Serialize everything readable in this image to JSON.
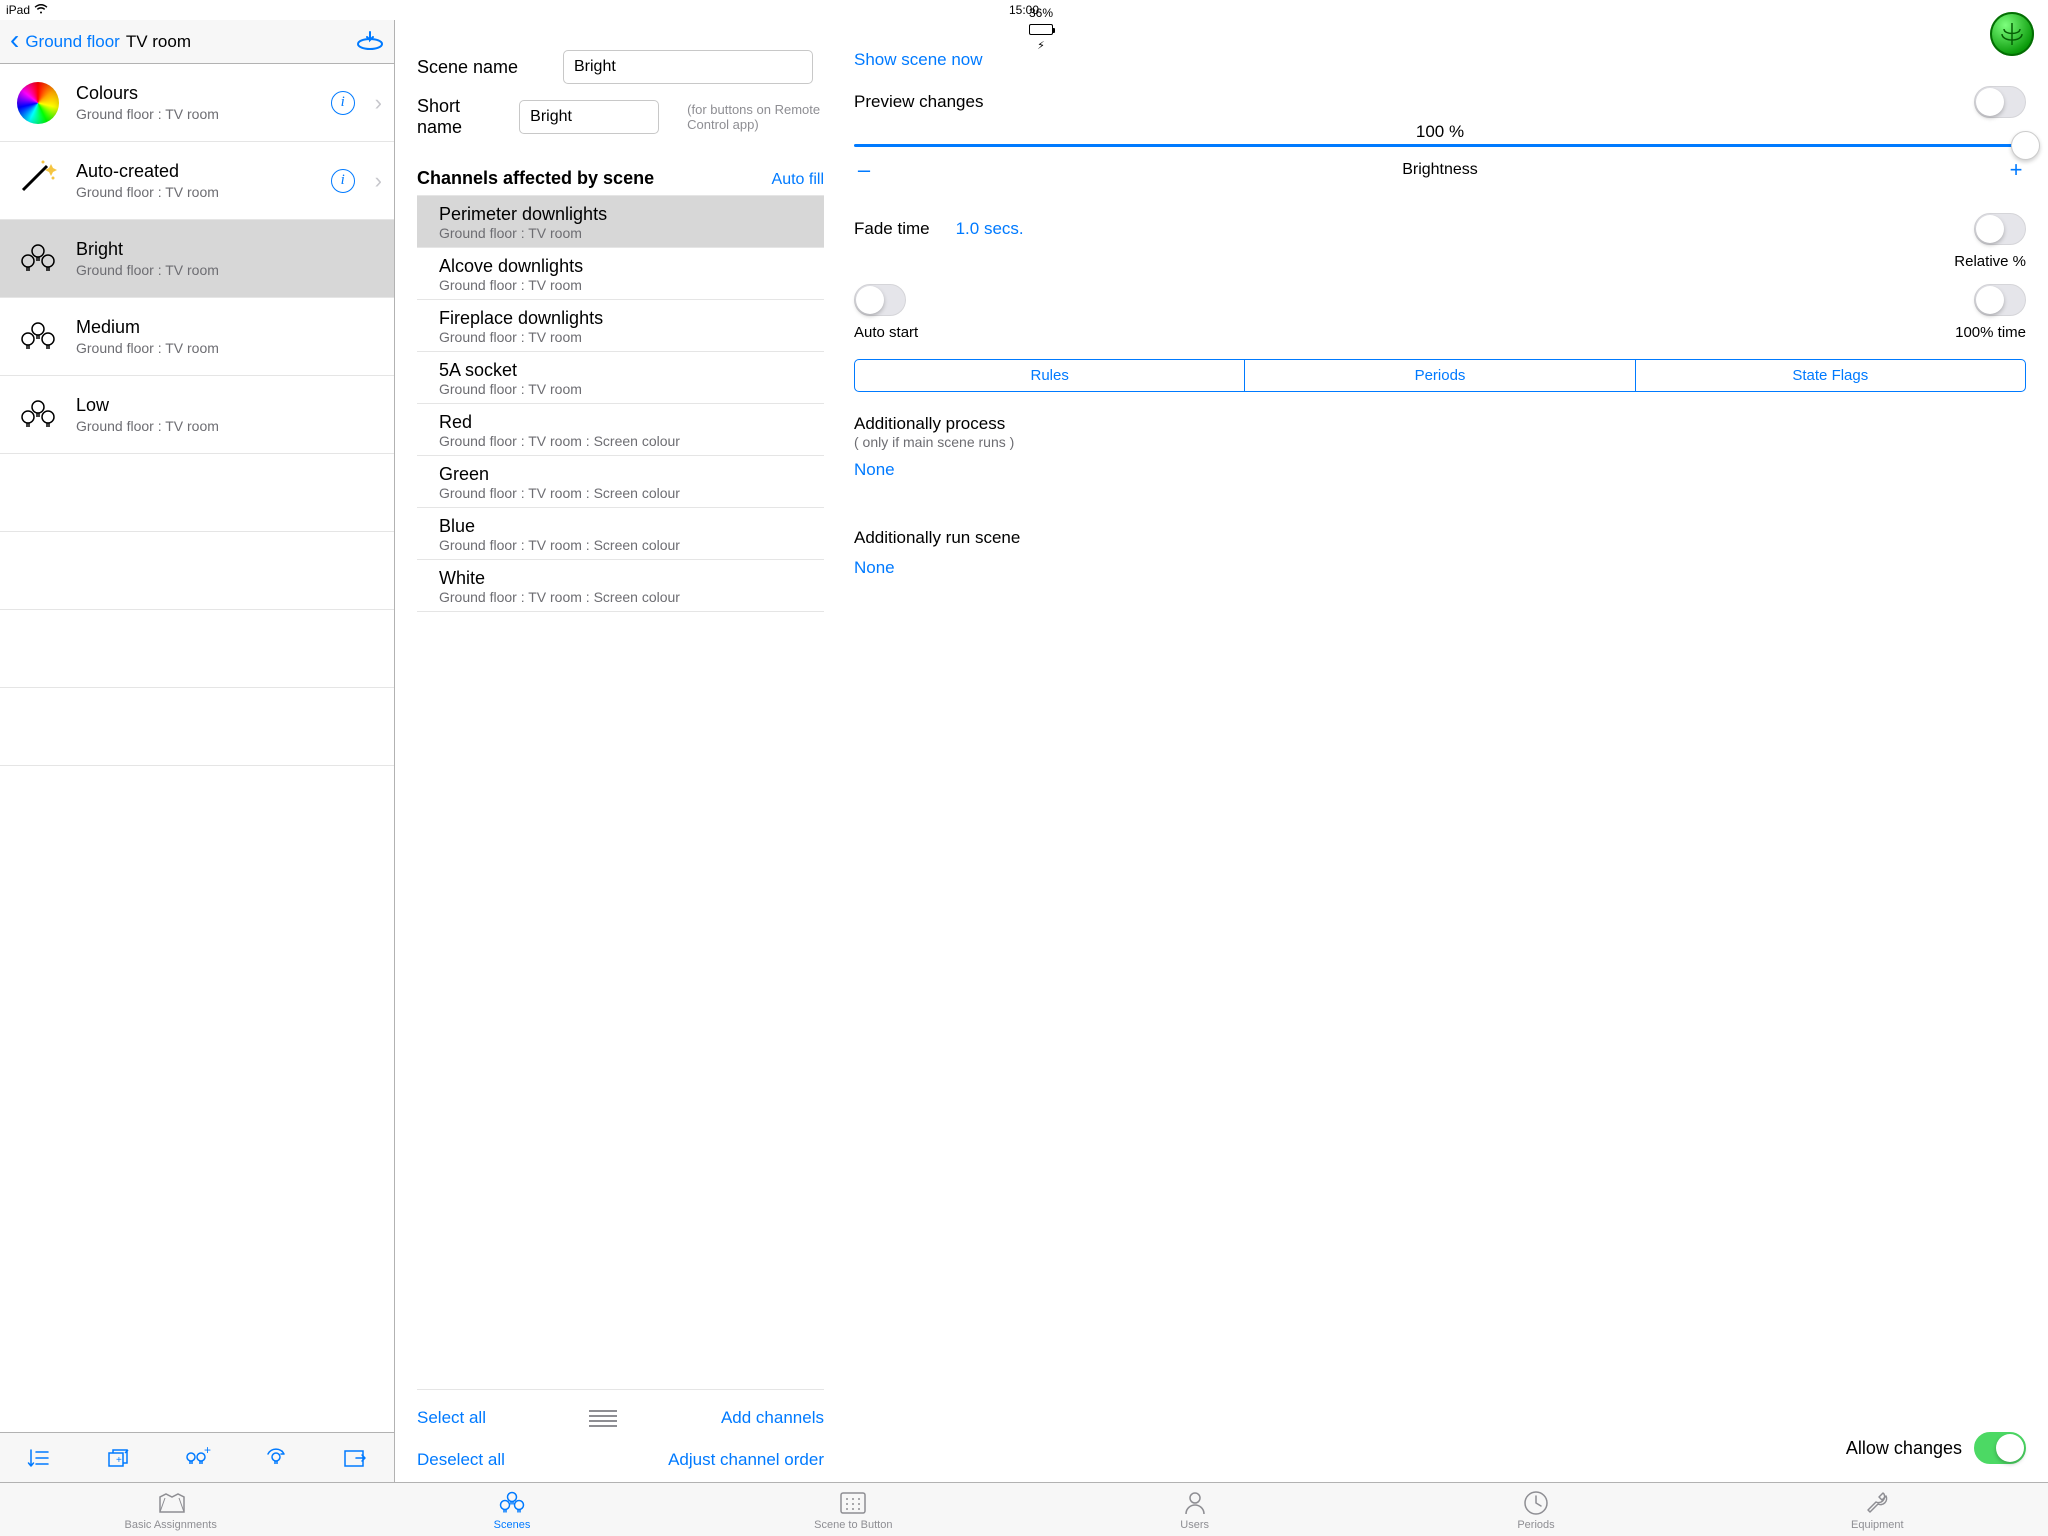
{
  "statusbar": {
    "device": "iPad",
    "time": "15:00",
    "battery_pct": "36%"
  },
  "sidebar": {
    "back": "Ground floor",
    "current": "TV room",
    "items": [
      {
        "title": "Colours",
        "sub": "Ground floor : TV room",
        "icon": "colour",
        "info": true
      },
      {
        "title": "Auto-created",
        "sub": "Ground floor : TV room",
        "icon": "wand",
        "info": true
      },
      {
        "title": "Bright",
        "sub": "Ground floor : TV room",
        "icon": "bulbs",
        "info": false,
        "selected": true
      },
      {
        "title": "Medium",
        "sub": "Ground floor : TV room",
        "icon": "bulbs",
        "info": false
      },
      {
        "title": "Low",
        "sub": "Ground floor : TV room",
        "icon": "bulbs",
        "info": false
      }
    ]
  },
  "scene": {
    "name_label": "Scene name",
    "name_value": "Bright",
    "short_label": "Short name",
    "short_value": "Bright",
    "short_hint": "(for buttons on Remote Control app)",
    "show_now": "Show scene now",
    "channels_head": "Channels affected by scene",
    "autofill": "Auto fill",
    "channels": [
      {
        "name": "Perimeter downlights",
        "loc": "Ground floor : TV room",
        "selected": true
      },
      {
        "name": "Alcove downlights",
        "loc": "Ground floor : TV room"
      },
      {
        "name": "Fireplace downlights",
        "loc": "Ground floor : TV room"
      },
      {
        "name": "5A socket",
        "loc": "Ground floor : TV room"
      },
      {
        "name": "Red",
        "loc": "Ground floor : TV room : Screen colour"
      },
      {
        "name": "Green",
        "loc": "Ground floor : TV room : Screen colour"
      },
      {
        "name": "Blue",
        "loc": "Ground floor : TV room : Screen colour"
      },
      {
        "name": "White",
        "loc": "Ground floor : TV room : Screen colour"
      }
    ],
    "select_all": "Select all",
    "deselect_all": "Deselect all",
    "add_channels": "Add channels",
    "adjust_order": "Adjust channel order"
  },
  "props": {
    "preview_label": "Preview changes",
    "brightness_pct": "100 %",
    "brightness_label": "Brightness",
    "fade_label": "Fade time",
    "fade_value": "1.0 secs.",
    "relative_label": "Relative %",
    "auto_start": "Auto start",
    "pct_time": "100% time",
    "seg": {
      "rules": "Rules",
      "periods": "Periods",
      "flags": "State Flags"
    },
    "add_process_head": "Additionally process",
    "add_process_hint": "( only if main scene runs )",
    "none": "None",
    "add_run_head": "Additionally run scene",
    "allow_changes": "Allow changes"
  },
  "tabs": [
    {
      "id": "basic",
      "label": "Basic Assignments"
    },
    {
      "id": "scenes",
      "label": "Scenes",
      "active": true
    },
    {
      "id": "s2b",
      "label": "Scene to Button"
    },
    {
      "id": "users",
      "label": "Users"
    },
    {
      "id": "periods",
      "label": "Periods"
    },
    {
      "id": "equip",
      "label": "Equipment"
    }
  ]
}
